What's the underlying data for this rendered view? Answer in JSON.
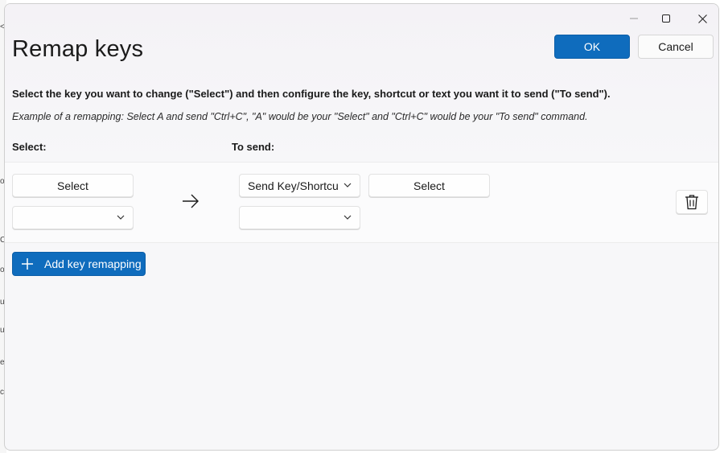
{
  "window": {
    "title": "Remap keys",
    "caption_buttons": [
      "minimize-icon",
      "maximize-icon",
      "close-icon"
    ]
  },
  "header": {
    "ok_label": "OK",
    "cancel_label": "Cancel"
  },
  "description": {
    "instruction": "Select the key you want to change (\"Select\") and then configure the key, shortcut or text you want it to send (\"To send\").",
    "example": "Example of a remapping: Select A and send \"Ctrl+C\", \"A\" would be your \"Select\" and \"Ctrl+C\" would be your \"To send\" command."
  },
  "columns": {
    "select": "Select:",
    "to_send": "To send:"
  },
  "remapping_row": {
    "select_button_label": "Select",
    "select_dropdown_value": "",
    "send_type_value": "Send Key/Shortcu",
    "send_select_button_label": "Select",
    "send_dropdown_value": ""
  },
  "add_button_label": "Add key remapping",
  "colors": {
    "accent": "#0f6cbd",
    "window_bg": "#f7f7f9",
    "card_bg": "#fbfbfc"
  },
  "icons": {
    "arrow": "arrow-right-icon",
    "delete": "trash-icon",
    "chevron": "chevron-down-icon",
    "plus": "plus-icon"
  }
}
